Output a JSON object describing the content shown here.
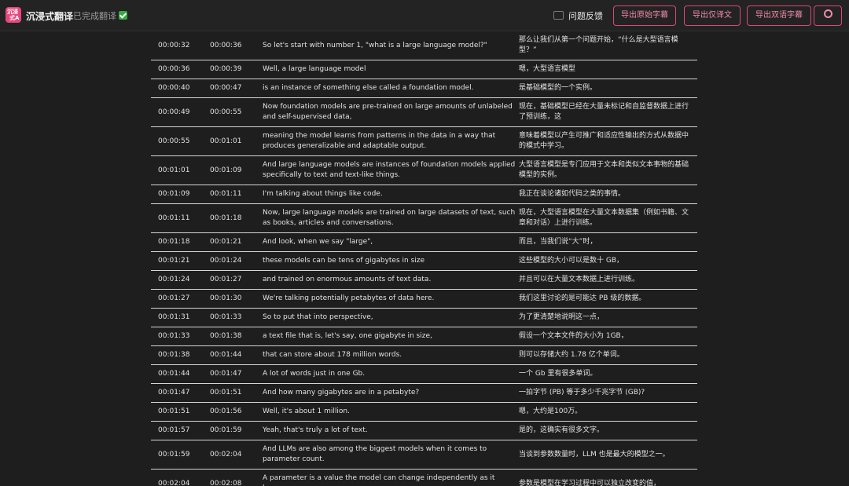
{
  "header": {
    "logo_text_top": "沉浸",
    "logo_text_bottom": "式A",
    "app_title": "沉浸式翻译",
    "status": "已完成翻译",
    "feedback": "问题反馈",
    "export_original": "导出原始字幕",
    "export_translation": "导出仅译文",
    "export_bilingual": "导出双语字幕",
    "accent_color": "#e8457e"
  },
  "subtitles": [
    {
      "start": "00:00:32",
      "end": "00:00:36",
      "en": "So let's start with number 1, \"what is a large language model?\"",
      "zh": "那么让我们从第一个问题开始，“什么是大型语言模型？”"
    },
    {
      "start": "00:00:36",
      "end": "00:00:39",
      "en": "Well, a large language model",
      "zh": "嗯，大型语言模型"
    },
    {
      "start": "00:00:40",
      "end": "00:00:47",
      "en": "is an instance of something else called a foundation model.",
      "zh": "是基础模型的一个实例。"
    },
    {
      "start": "00:00:49",
      "end": "00:00:55",
      "en": "Now foundation models are pre-trained on large amounts of unlabeled and self-supervised data,",
      "zh": "现在，基础模型已经在大量未标记和自监督数据上进行了预训练，这"
    },
    {
      "start": "00:00:55",
      "end": "00:01:01",
      "en": "meaning the model learns from patterns in the data in a way that produces generalizable and adaptable output.",
      "zh": "意味着模型以产生可推广和适应性输出的方式从数据中的模式中学习。"
    },
    {
      "start": "00:01:01",
      "end": "00:01:09",
      "en": "And large language models are instances of foundation models applied specifically to text and text-like things.",
      "zh": "大型语言模型是专门应用于文本和类似文本事物的基础模型的实例。"
    },
    {
      "start": "00:01:09",
      "end": "00:01:11",
      "en": "I'm talking about things like code.",
      "zh": "我正在谈论诸如代码之类的事情。"
    },
    {
      "start": "00:01:11",
      "end": "00:01:18",
      "en": "Now, large language models are trained on large datasets of text, such as books, articles and conversations.",
      "zh": "现在，大型语言模型在大量文本数据集（例如书籍、文章和对话）上进行训练。"
    },
    {
      "start": "00:01:18",
      "end": "00:01:21",
      "en": "And look, when we say \"large\",",
      "zh": "而且，当我们说“大”时，"
    },
    {
      "start": "00:01:21",
      "end": "00:01:24",
      "en": "these models can be tens of gigabytes in size",
      "zh": "这些模型的大小可以是数十 GB，"
    },
    {
      "start": "00:01:24",
      "end": "00:01:27",
      "en": "and trained on enormous amounts of text data.",
      "zh": "并且可以在大量文本数据上进行训练。"
    },
    {
      "start": "00:01:27",
      "end": "00:01:30",
      "en": "We're talking potentially petabytes of data here.",
      "zh": "我们这里讨论的是可能达 PB 级的数据。"
    },
    {
      "start": "00:01:31",
      "end": "00:01:33",
      "en": "So to put that into perspective,",
      "zh": "为了更清楚地说明这一点，"
    },
    {
      "start": "00:01:33",
      "end": "00:01:38",
      "en": "a text file that is, let's say, one gigabyte in size,",
      "zh": "假设一个文本文件的大小为 1GB，"
    },
    {
      "start": "00:01:38",
      "end": "00:01:44",
      "en": "that can store about 178 million words.",
      "zh": "则可以存储大约 1.78 亿个单词。"
    },
    {
      "start": "00:01:44",
      "end": "00:01:47",
      "en": "A lot of words just in one Gb.",
      "zh": "一个 Gb 里有很多单词。"
    },
    {
      "start": "00:01:47",
      "end": "00:01:51",
      "en": "And how many gigabytes are in a petabyte?",
      "zh": "一拍字节 (PB) 等于多少千兆字节 (GB)?"
    },
    {
      "start": "00:01:51",
      "end": "00:01:56",
      "en": "Well, it's about 1 million.",
      "zh": "嗯，大约是100万。"
    },
    {
      "start": "00:01:57",
      "end": "00:01:59",
      "en": "Yeah, that's truly a lot of text.",
      "zh": "是的，这确实有很多文字。"
    },
    {
      "start": "00:01:59",
      "end": "00:02:04",
      "en": "And LLMs are also among the biggest models when it comes to parameter count.",
      "zh": "当谈到参数数量时，LLM 也是最大的模型之一。"
    },
    {
      "start": "00:02:04",
      "end": "00:02:08",
      "en": "A parameter is a value the model can change independently as it learns,",
      "zh": "参数是模型在学习过程中可以独立改变的值，"
    }
  ]
}
